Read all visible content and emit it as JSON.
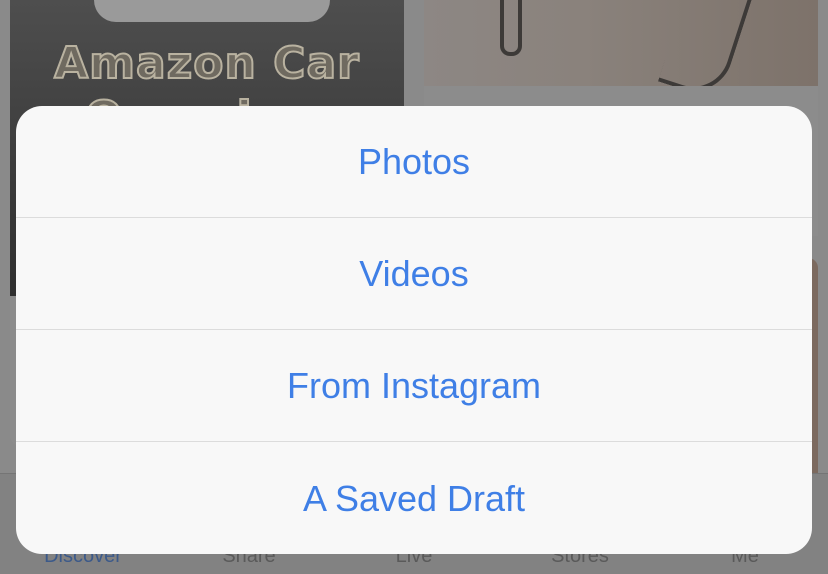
{
  "background": {
    "left_card": {
      "overlay_line_1": "Amazon Car",
      "overlay_line_2": "Organizer"
    }
  },
  "tab_bar": {
    "items": [
      {
        "label": "Discover",
        "active": true
      },
      {
        "label": "Share",
        "active": false
      },
      {
        "label": "Live",
        "active": false
      },
      {
        "label": "Stores",
        "active": false
      },
      {
        "label": "Me",
        "active": false
      }
    ]
  },
  "action_sheet": {
    "options": [
      {
        "label": "Photos"
      },
      {
        "label": "Videos"
      },
      {
        "label": "From Instagram"
      },
      {
        "label": "A Saved Draft"
      }
    ]
  },
  "colors": {
    "accent": "#3f7fe6",
    "sheet_background": "#f8f8f8",
    "separator": "#dcdcdc",
    "tab_active": "#3c5a8a"
  }
}
